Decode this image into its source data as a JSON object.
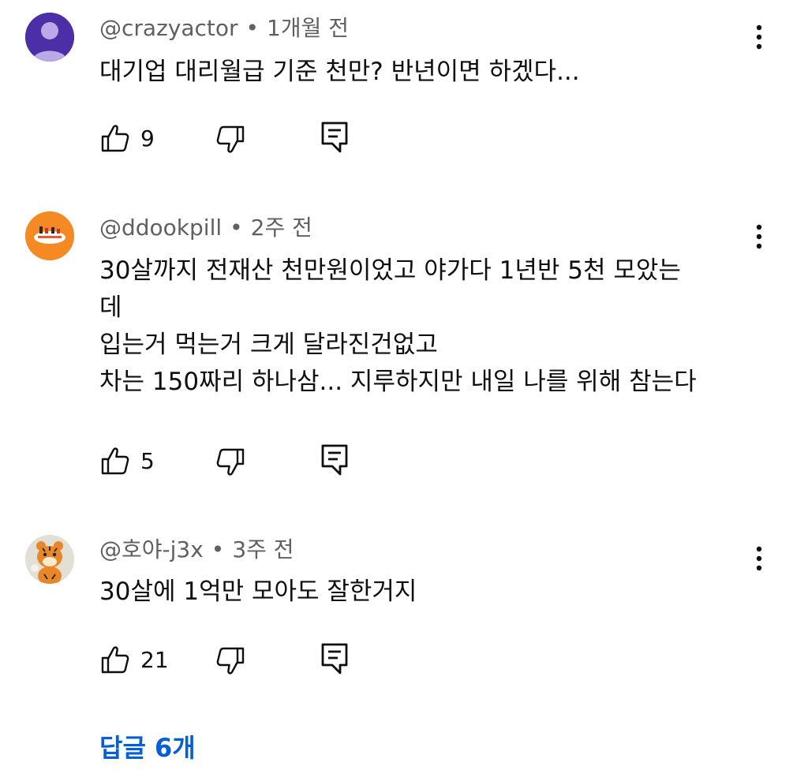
{
  "comments": [
    {
      "username": "@crazyactor",
      "separator": "•",
      "time": "1개월 전",
      "lines": [
        "대기업 대리월급 기준 천만? 반년이면 하겠다..."
      ],
      "likes": "9"
    },
    {
      "username": "@ddookpill",
      "separator": "•",
      "time": "2주 전",
      "lines": [
        "30살까지 전재산 천만원이었고 야가다 1년반 5천 모았는",
        "데",
        "입는거 먹는거 크게 달라진건없고",
        "차는 150짜리 하나삼... 지루하지만 내일 나를 위해 참는다"
      ],
      "likes": "5"
    },
    {
      "username": "@호야-j3x",
      "separator": "•",
      "time": "3주 전",
      "lines": [
        "30살에 1억만 모아도 잘한거지"
      ],
      "likes": "21"
    }
  ],
  "replies_link": "답글 6개",
  "icons": {
    "like": "thumb-up-icon",
    "dislike": "thumb-down-icon",
    "reply": "reply-comment-icon",
    "menu": "more-vertical-icon"
  },
  "colors": {
    "text": "#0f0f0f",
    "meta": "#606060",
    "link": "#065fd4",
    "avatar1_bg": "#4b2fa6",
    "avatar2_bg": "#f58a25",
    "avatar3_bg": "#e2e0d6"
  }
}
